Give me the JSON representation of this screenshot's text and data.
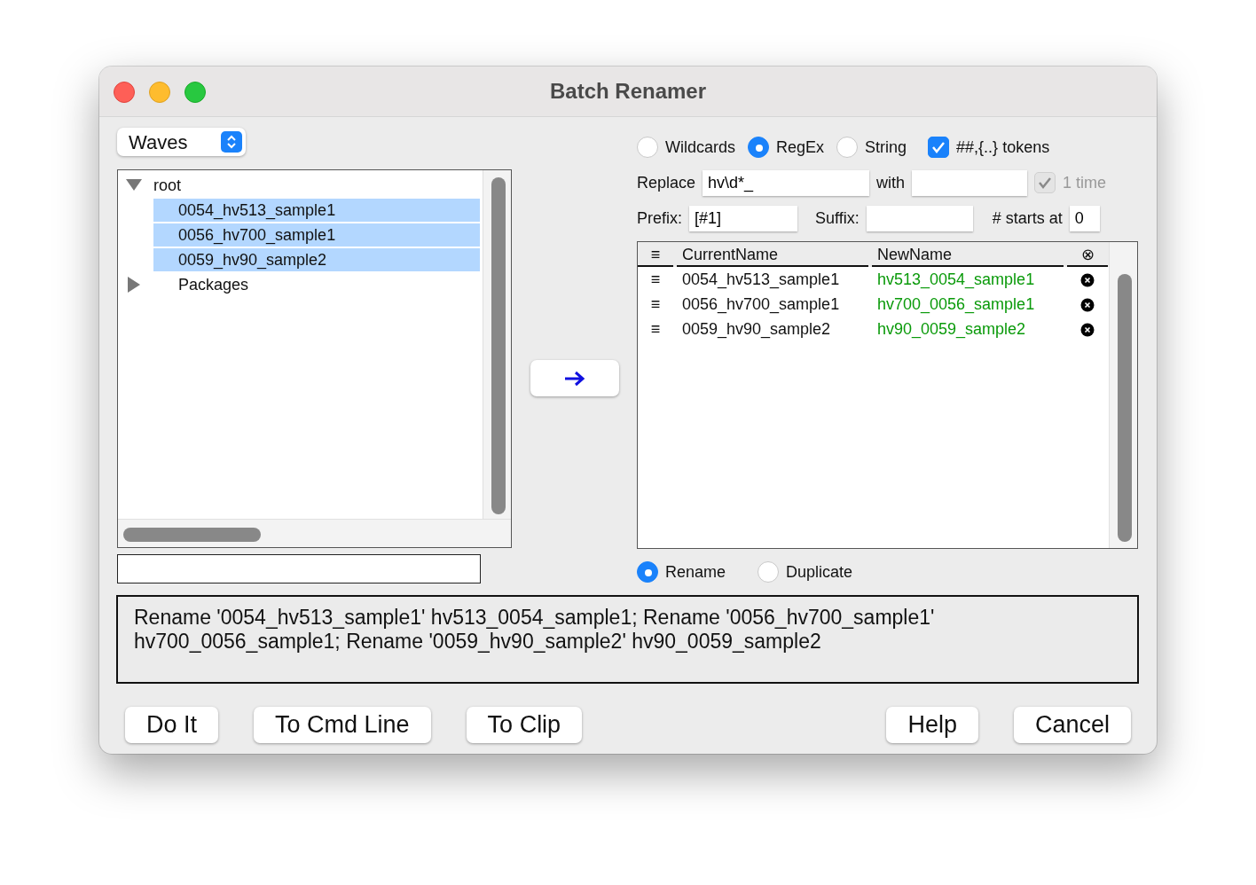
{
  "window": {
    "title": "Batch Renamer"
  },
  "source_popup": {
    "value": "Waves"
  },
  "tree": [
    {
      "label": "root",
      "expanded": true,
      "selected": false,
      "children": [
        {
          "label": "0054_hv513_sample1",
          "selected": true
        },
        {
          "label": "0056_hv700_sample1",
          "selected": true
        },
        {
          "label": "0059_hv90_sample2",
          "selected": true
        }
      ]
    },
    {
      "label": "Packages",
      "expanded": false,
      "selected": false
    }
  ],
  "match_modes": [
    {
      "label": "Wildcards",
      "selected": false
    },
    {
      "label": "RegEx",
      "selected": true
    },
    {
      "label": "String",
      "selected": false
    }
  ],
  "tokens_checkbox": {
    "label": "##,{..} tokens",
    "checked": true
  },
  "replace": {
    "label": "Replace",
    "value": "hv\\d*_",
    "with_label": "with",
    "once_checkbox": {
      "label": "1 time",
      "checked": true,
      "disabled": true
    }
  },
  "prefix": {
    "label": "Prefix:",
    "value": "[#1]"
  },
  "suffix": {
    "label": "Suffix:"
  },
  "start": {
    "label": "# starts at",
    "value": "0"
  },
  "table": {
    "columns": [
      "≡",
      "CurrentName",
      "NewName",
      "⊗"
    ],
    "rows": [
      {
        "handle": "≡",
        "current": "0054_hv513_sample1",
        "new": "hv513_0054_sample1"
      },
      {
        "handle": "≡",
        "current": "0056_hv700_sample1",
        "new": "hv700_0056_sample1"
      },
      {
        "handle": "≡",
        "current": "0059_hv90_sample2",
        "new": "hv90_0059_sample2"
      }
    ]
  },
  "actions": [
    {
      "label": "Rename",
      "selected": true
    },
    {
      "label": "Duplicate",
      "selected": false
    }
  ],
  "command_text": "Rename '0054_hv513_sample1' hv513_0054_sample1; Rename '0056_hv700_sample1' hv700_0056_sample1; Rename '0059_hv90_sample2' hv90_0059_sample2",
  "buttons_left": [
    "Do It",
    "To Cmd Line",
    "To Clip"
  ],
  "buttons_right": [
    "Help",
    "Cancel"
  ]
}
